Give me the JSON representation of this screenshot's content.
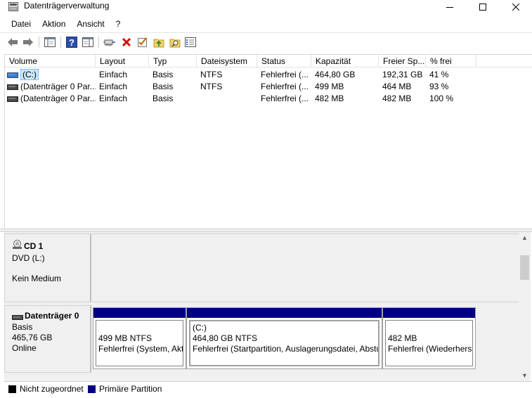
{
  "window": {
    "title": "Datenträgerverwaltung"
  },
  "menu": [
    "Datei",
    "Aktion",
    "Ansicht",
    "?"
  ],
  "toolbar": {
    "icons": [
      "back-arrow-icon",
      "forward-arrow-icon",
      "console-tree-icon",
      "help-icon",
      "properties-pane-icon",
      "connect-icon",
      "delete-icon",
      "check-icon",
      "folder-up-icon",
      "search-folder-icon",
      "settings-list-icon"
    ]
  },
  "volume_list": {
    "columns": [
      "Volume",
      "Layout",
      "Typ",
      "Dateisystem",
      "Status",
      "Kapazität",
      "Freier Sp...",
      "% frei"
    ],
    "rows": [
      {
        "volume": "(C:)",
        "layout": "Einfach",
        "typ": "Basis",
        "dateisystem": "NTFS",
        "status": "Fehlerfrei (...",
        "kapazitaet": "464,80 GB",
        "frei": "192,31 GB",
        "prozent": "41 %",
        "selected": true
      },
      {
        "volume": "(Datenträger 0 Par...",
        "layout": "Einfach",
        "typ": "Basis",
        "dateisystem": "NTFS",
        "status": "Fehlerfrei (...",
        "kapazitaet": "499 MB",
        "frei": "464 MB",
        "prozent": "93 %",
        "selected": false
      },
      {
        "volume": "(Datenträger 0 Par...",
        "layout": "Einfach",
        "typ": "Basis",
        "dateisystem": "",
        "status": "Fehlerfrei (...",
        "kapazitaet": "482 MB",
        "frei": "482 MB",
        "prozent": "100 %",
        "selected": false
      }
    ]
  },
  "disks": {
    "cd1": {
      "name": "CD 1",
      "type": "DVD (L:)",
      "media": "Kein Medium"
    },
    "disk0": {
      "name": "Datenträger 0",
      "type": "Basis",
      "size": "465,76 GB",
      "state": "Online",
      "partitions": [
        {
          "label": "",
          "size": "499 MB NTFS",
          "status": "Fehlerfrei (System, Akt"
        },
        {
          "label": "(C:)",
          "size": "464,80 GB NTFS",
          "status": "Fehlerfrei (Startpartition, Auslagerungsdatei, Absturz"
        },
        {
          "label": "",
          "size": "482 MB",
          "status": "Fehlerfrei (Wiederherst"
        }
      ]
    }
  },
  "legend": [
    {
      "label": "Nicht zugeordnet",
      "color": "#000000"
    },
    {
      "label": "Primäre Partition",
      "color": "#000080"
    }
  ],
  "colors": {
    "partition_bar": "#000080",
    "selection": "#cce8ff"
  }
}
